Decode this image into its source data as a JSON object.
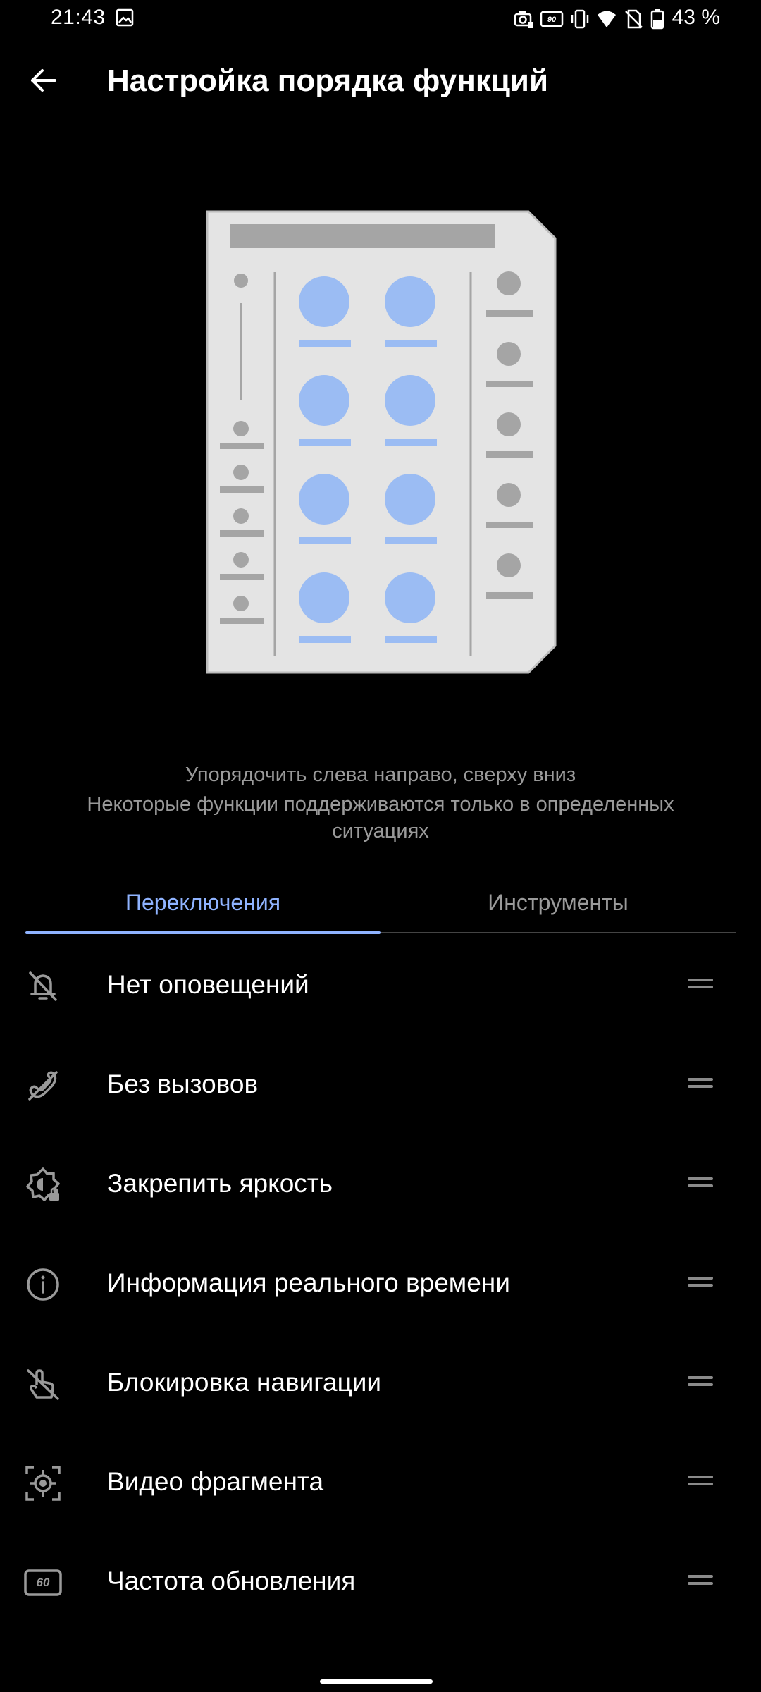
{
  "status_bar": {
    "time": "21:43",
    "battery_percent": "43 %",
    "refresh_badge": "90",
    "icons": [
      "gallery-icon",
      "camera-icon",
      "refresh-rate-icon",
      "vibrate-icon",
      "wifi-icon",
      "no-sim-icon",
      "battery-icon"
    ]
  },
  "header": {
    "title": "Настройка порядка функций"
  },
  "hint": {
    "line1": "Упорядочить слева направо, сверху вниз",
    "line2": "Некоторые функции поддерживаются только в определенных ситуациях"
  },
  "tabs": [
    {
      "label": "Переключения",
      "selected": true
    },
    {
      "label": "Инструменты",
      "selected": false
    }
  ],
  "items": [
    {
      "label": "Нет оповещений",
      "icon": "bell-off-icon"
    },
    {
      "label": "Без вызовов",
      "icon": "phone-off-icon"
    },
    {
      "label": "Закрепить яркость",
      "icon": "brightness-lock-icon"
    },
    {
      "label": "Информация реального времени",
      "icon": "info-icon"
    },
    {
      "label": "Блокировка навигации",
      "icon": "nav-lock-icon"
    },
    {
      "label": "Видео фрагмента",
      "icon": "video-clip-icon"
    },
    {
      "label": "Частота обновления",
      "icon": "refresh-rate-icon"
    }
  ],
  "refresh_item_badge": "60",
  "colors": {
    "accent": "#8fb3ff",
    "background": "#000000",
    "text_secondary": "#9a9a9a",
    "illustration_panel": "#e4e4e4",
    "illustration_blue": "#9bbcf3",
    "illustration_gray": "#a5a5a5"
  }
}
